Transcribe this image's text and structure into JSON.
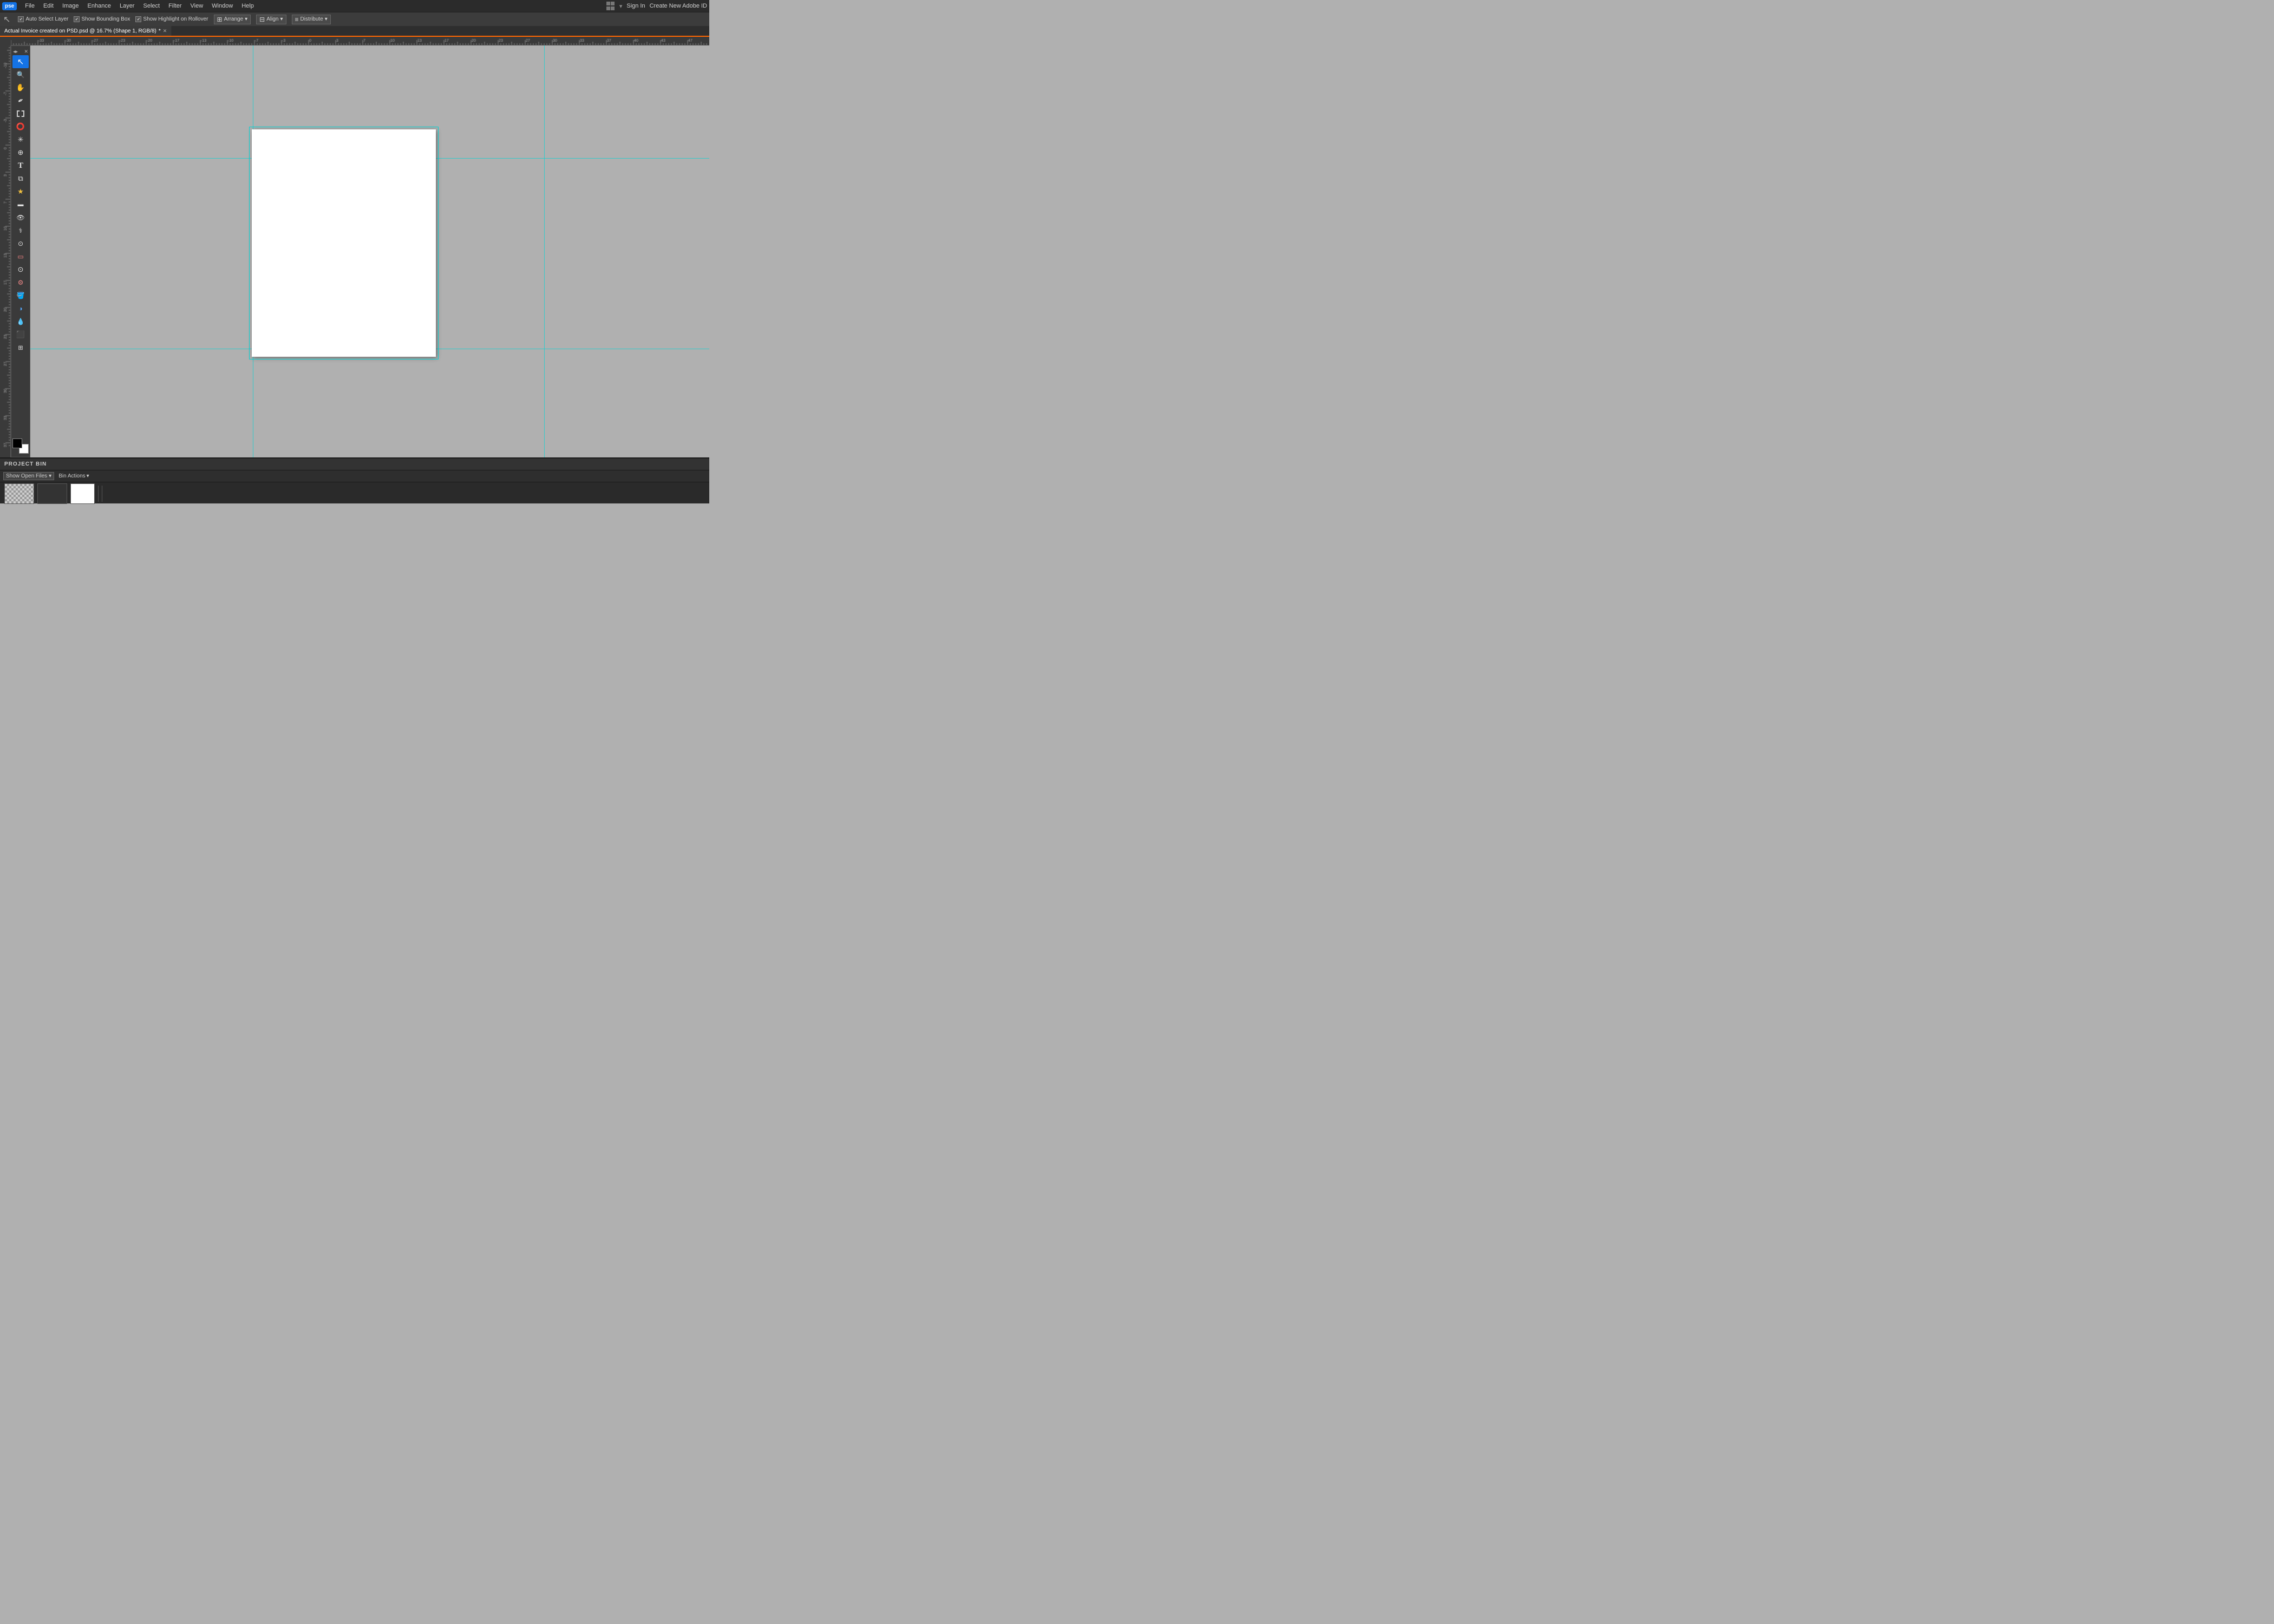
{
  "app": {
    "logo": "pse",
    "menu_items": [
      "File",
      "Edit",
      "Image",
      "Enhance",
      "Layer",
      "Select",
      "Filter",
      "View",
      "Window",
      "Help"
    ],
    "sign_in": "Sign In",
    "create_id": "Create New Adobe ID"
  },
  "options_bar": {
    "move_tool_label": "▶",
    "auto_select": "Auto Select Layer",
    "show_bounding_box": "Show Bounding Box",
    "show_highlight": "Show Highlight on Rollover",
    "arrange_label": "Arrange",
    "align_label": "Align",
    "distribute_label": "Distribute"
  },
  "tab": {
    "title": "Actual Invoice created on PSD.psd @ 16.7% (Shape 1, RGB/8)",
    "modified": "*"
  },
  "toolbar": {
    "tools": [
      {
        "name": "move",
        "icon": "↖",
        "active": true
      },
      {
        "name": "zoom",
        "icon": "🔍"
      },
      {
        "name": "hand",
        "icon": "✋"
      },
      {
        "name": "eyedropper",
        "icon": "✒"
      },
      {
        "name": "rect-marquee",
        "icon": "⬜"
      },
      {
        "name": "lasso",
        "icon": "⭕"
      },
      {
        "name": "magic-wand",
        "icon": "✳"
      },
      {
        "name": "quick-selection",
        "icon": "⊕"
      },
      {
        "name": "type",
        "icon": "T"
      },
      {
        "name": "crop",
        "icon": "⧉"
      },
      {
        "name": "custom-shape",
        "icon": "★"
      },
      {
        "name": "smart-brush",
        "icon": "▬"
      },
      {
        "name": "red-eye",
        "icon": "👁"
      },
      {
        "name": "spot-healing",
        "icon": "⚕"
      },
      {
        "name": "healing",
        "icon": "🔧"
      },
      {
        "name": "blur",
        "icon": "💧"
      },
      {
        "name": "clone",
        "icon": "⊙"
      },
      {
        "name": "custom-color",
        "icon": "⚙"
      },
      {
        "name": "paint-bucket",
        "icon": "🪣"
      },
      {
        "name": "gradient",
        "icon": "◑"
      },
      {
        "name": "gradient2",
        "icon": "▼"
      },
      {
        "name": "drop",
        "icon": "💧"
      },
      {
        "name": "shape",
        "icon": "⬛"
      },
      {
        "name": "coords",
        "icon": "⊞"
      }
    ]
  },
  "project_bin": {
    "title": "PROJECT BIN",
    "show_open_files": "Show Open Files",
    "bin_actions": "Bin Actions",
    "thumbnails": [
      {
        "type": "checker",
        "label": ""
      },
      {
        "type": "dark",
        "label": ""
      },
      {
        "type": "white",
        "label": ""
      },
      {
        "type": "sep",
        "label": ""
      },
      {
        "type": "sep2",
        "label": ""
      }
    ]
  },
  "canvas": {
    "doc_bg": "white",
    "zoom": "16.7%"
  },
  "colors": {
    "accent_orange": "#ff6600",
    "accent_cyan": "#00d5d5",
    "pse_blue": "#1473e6",
    "bg_dark": "#2b2b2b",
    "bg_mid": "#3c3c3c",
    "bg_canvas": "#b0b0b0"
  }
}
